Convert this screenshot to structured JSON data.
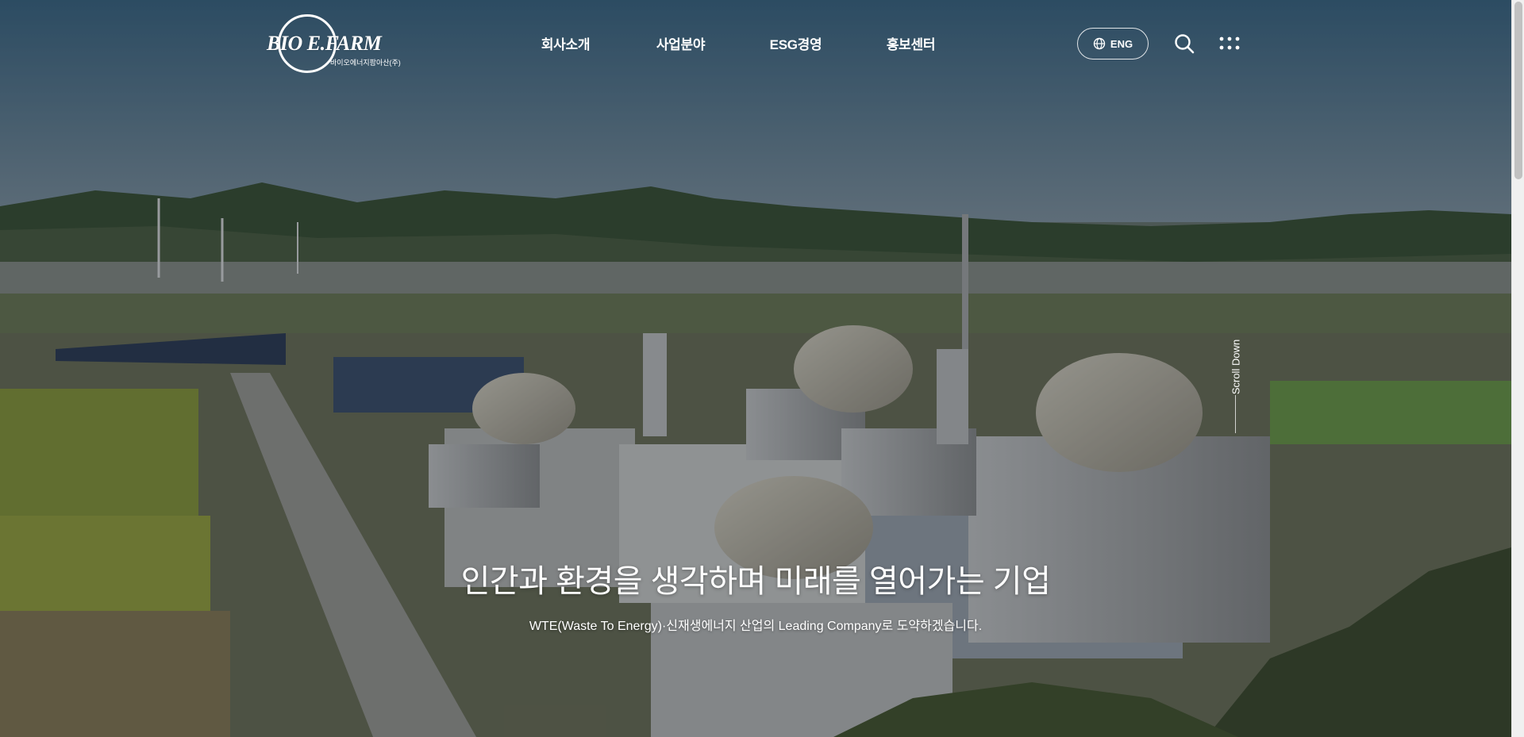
{
  "header": {
    "logo": {
      "wordmark": "BIO E.FARM",
      "subtitle": "바이오에너지팜아산(주)"
    },
    "nav": [
      {
        "label": "회사소개"
      },
      {
        "label": "사업분야"
      },
      {
        "label": "ESG경영"
      },
      {
        "label": "홍보센터"
      }
    ],
    "language_label": "ENG",
    "icons": {
      "language": "globe-icon",
      "search": "search-icon",
      "menu": "grid-menu-icon"
    }
  },
  "hero": {
    "headline": "인간과 환경을 생각하며 미래를 열어가는 기업",
    "subline": "WTE(Waste To Energy)·신재생에너지 산업의 Leading Company로 도약하겠습니다.",
    "scroll_label": "Scroll Down"
  },
  "colors": {
    "text": "#ffffff",
    "sky": "#4a7592",
    "scrollbar_track": "#f0f0f0",
    "scrollbar_thumb": "#c1c1c1"
  }
}
